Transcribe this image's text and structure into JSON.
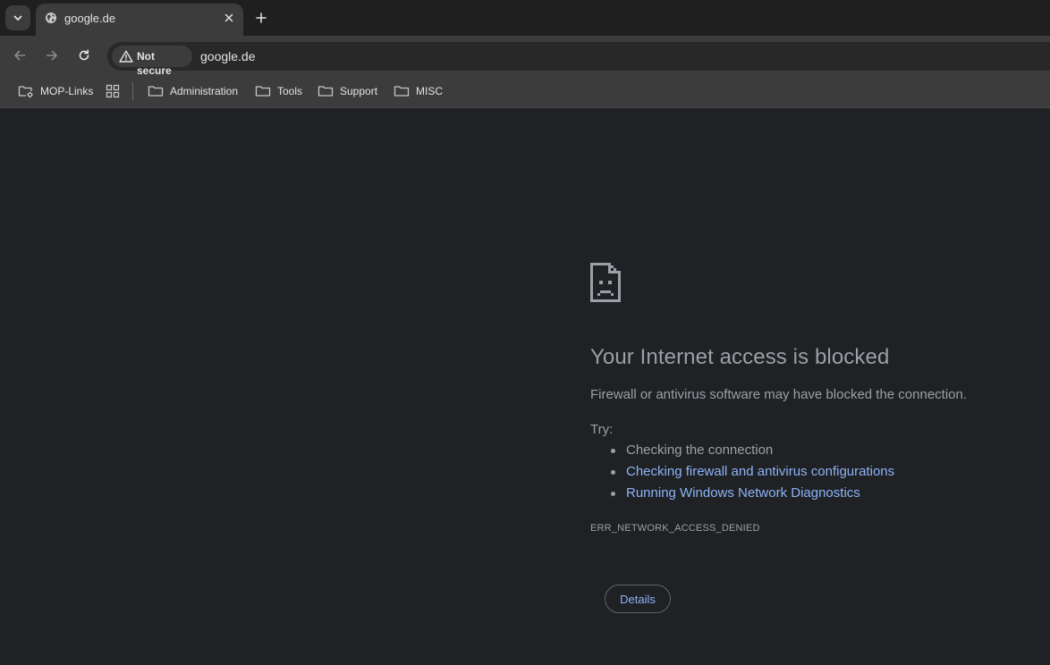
{
  "tab": {
    "title": "google.de",
    "favicon": "globe-icon"
  },
  "toolbar": {
    "security_label": "Not secure",
    "url": "google.de"
  },
  "bookmarks": [
    {
      "label": "MOP-Links",
      "icon": "folder-gear-icon"
    },
    {
      "label": "",
      "icon": "apps-grid-icon"
    },
    {
      "label": "Administration",
      "icon": "folder-icon"
    },
    {
      "label": "Tools",
      "icon": "folder-icon"
    },
    {
      "label": "Support",
      "icon": "folder-icon"
    },
    {
      "label": "MISC",
      "icon": "folder-icon"
    }
  ],
  "error": {
    "icon": "sad-document-icon",
    "heading": "Your Internet access is blocked",
    "description": "Firewall or antivirus software may have blocked the connection.",
    "try_label": "Try:",
    "suggestions": [
      {
        "text": "Checking the connection",
        "is_link": false
      },
      {
        "text": "Checking firewall and antivirus configurations",
        "is_link": true
      },
      {
        "text": "Running Windows Network Diagnostics",
        "is_link": true
      }
    ],
    "code": "ERR_NETWORK_ACCESS_DENIED",
    "details_label": "Details"
  },
  "colors": {
    "page_background": "#202124",
    "toolbar_background": "#3c3c3c",
    "text_secondary": "#9aa0a6",
    "link": "#8ab4f8"
  }
}
